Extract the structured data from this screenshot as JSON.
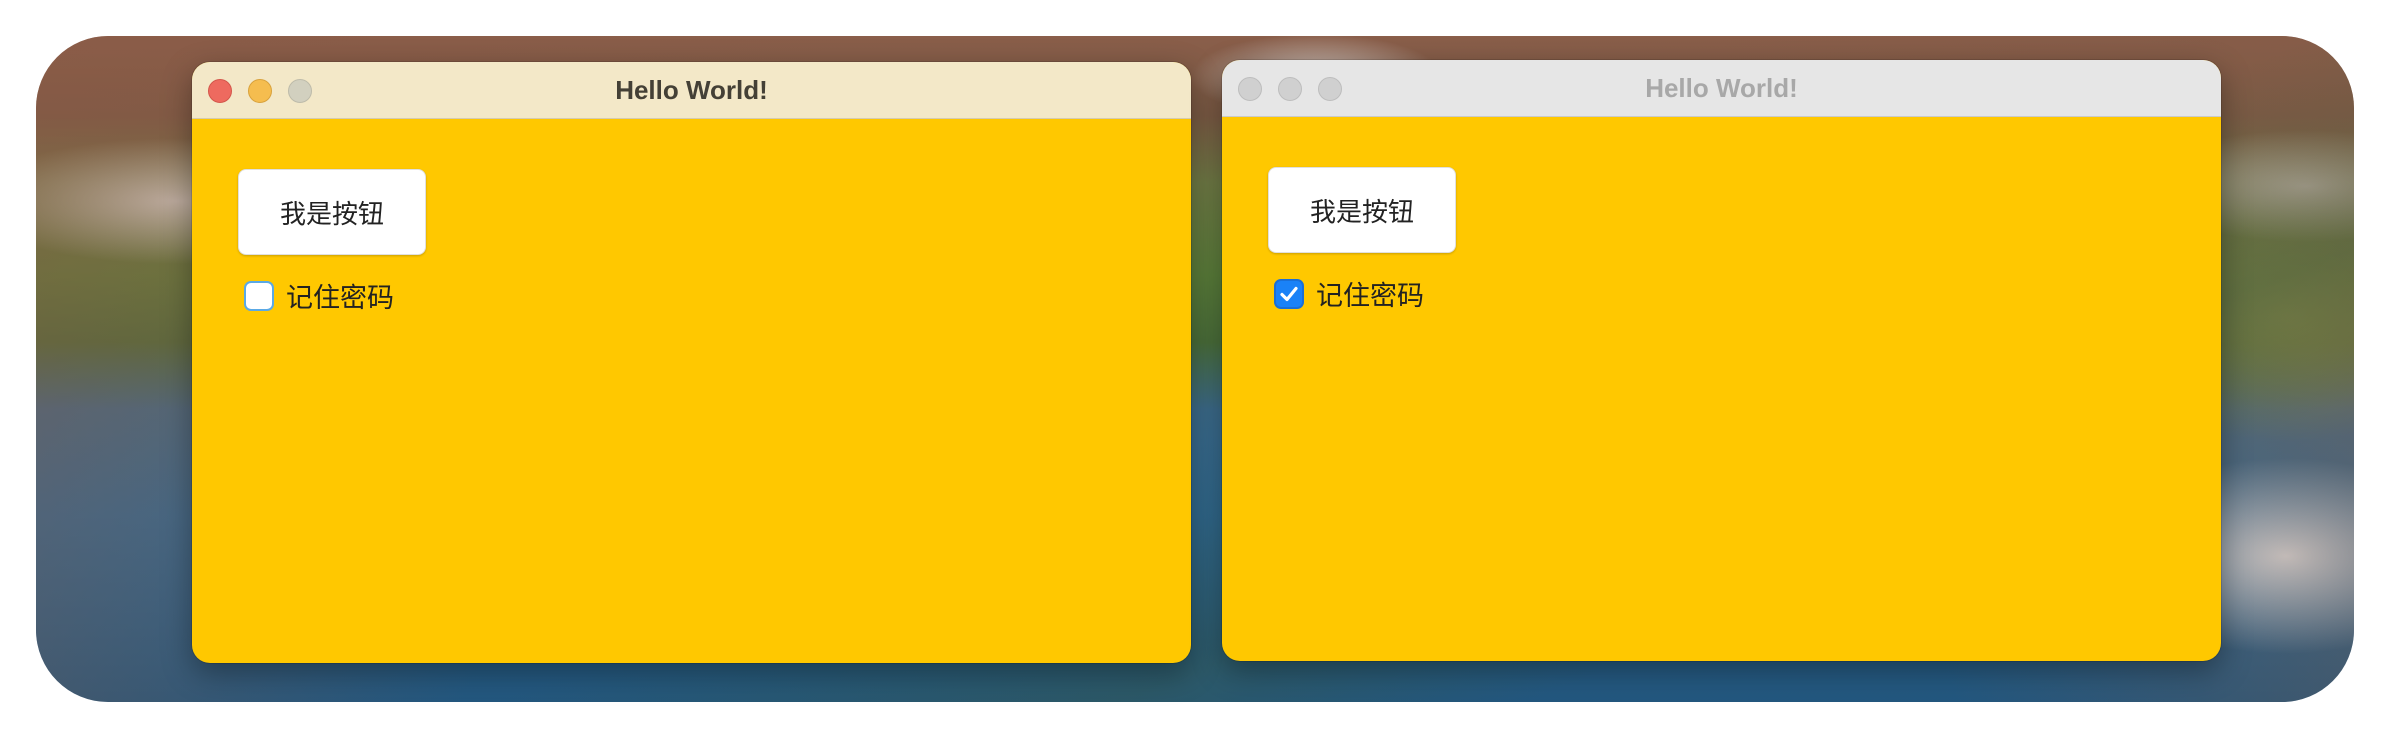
{
  "windows": [
    {
      "title": "Hello World!",
      "active": true,
      "button_label": "我是按钮",
      "checkbox_label": "记住密码",
      "checkbox_checked": false
    },
    {
      "title": "Hello World!",
      "active": false,
      "button_label": "我是按钮",
      "checkbox_label": "记住密码",
      "checkbox_checked": true
    }
  ],
  "colors": {
    "window_background": "#ffc800",
    "active_titlebar": "#f3e8c8",
    "inactive_titlebar": "#e6e6e6",
    "checkbox_checked": "#1a82f7"
  },
  "icons": {
    "close": "close-icon",
    "minimize": "minimize-icon",
    "zoom": "zoom-icon",
    "checkmark": "checkmark-icon"
  }
}
